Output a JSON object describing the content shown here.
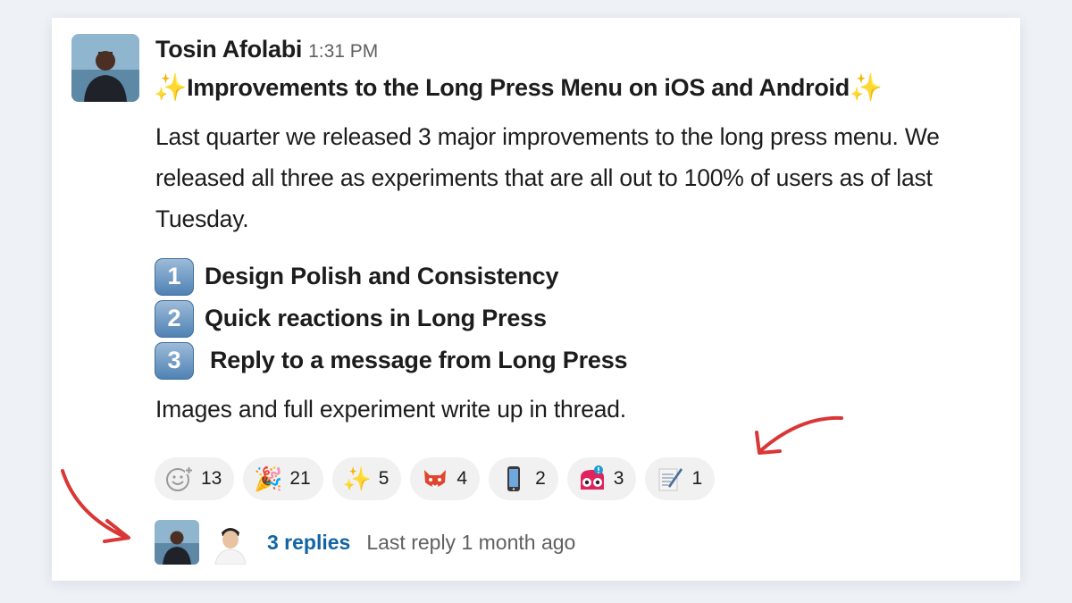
{
  "message": {
    "author": "Tosin Afolabi",
    "time": "1:31 PM",
    "title_sparkle_left": "✨",
    "title": "Improvements to the Long Press Menu on iOS and Android",
    "title_sparkle_right": "✨",
    "body": "Last quarter we released 3 major improvements to the long press menu. We released all three as experiments that are all out to 100% of users as of last Tuesday.",
    "list": [
      {
        "num": "1",
        "label": "Design Polish and Consistency"
      },
      {
        "num": "2",
        "label": "Quick reactions in Long Press"
      },
      {
        "num": "3",
        "label": "Reply to a message from Long Press"
      }
    ],
    "footer": "Images and full experiment write up in thread."
  },
  "reactions": [
    {
      "icon": "add-reaction-icon",
      "glyph": "",
      "count": "13"
    },
    {
      "icon": "party-popper-icon",
      "glyph": "🎉",
      "count": "21"
    },
    {
      "icon": "sparkles-icon",
      "glyph": "✨",
      "count": "5"
    },
    {
      "icon": "fox-icon",
      "glyph": "",
      "count": "4"
    },
    {
      "icon": "mobile-phone-icon",
      "glyph": "",
      "count": "2"
    },
    {
      "icon": "owl-alert-icon",
      "glyph": "",
      "count": "3"
    },
    {
      "icon": "memo-icon",
      "glyph": "",
      "count": "1"
    }
  ],
  "thread": {
    "replies": "3 replies",
    "last_reply": "Last reply 1 month ago"
  },
  "colors": {
    "link": "#1264a3",
    "annotation_arrow": "#d93636",
    "keycap": "#4f82b4",
    "sparkle": "#f2c231"
  }
}
